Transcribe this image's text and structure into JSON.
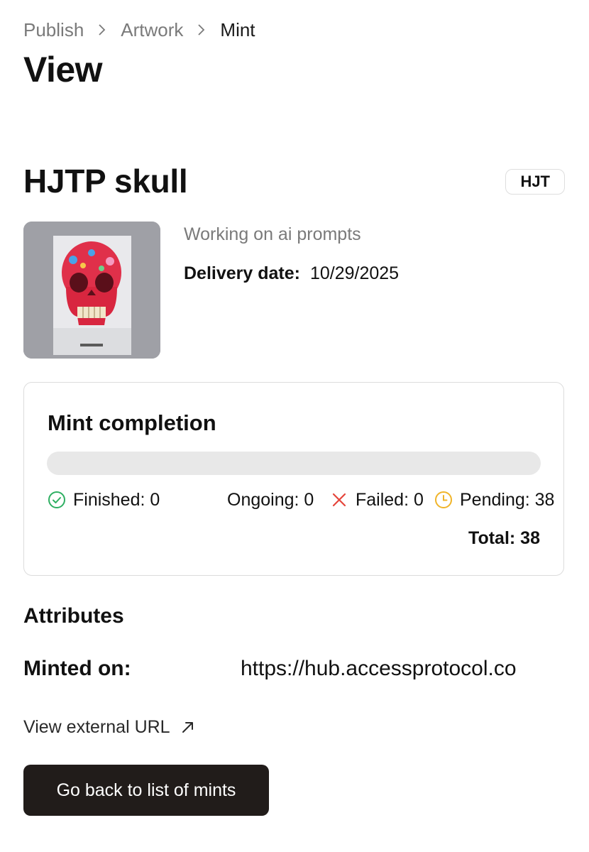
{
  "breadcrumb": {
    "items": [
      {
        "label": "Publish"
      },
      {
        "label": "Artwork"
      },
      {
        "label": "Mint"
      }
    ]
  },
  "page": {
    "title": "View"
  },
  "mint": {
    "name": "HJTP skull",
    "tag": "HJT",
    "description": "Working on ai prompts",
    "delivery_label": "Delivery date:",
    "delivery_date": "10/29/2025",
    "thumbnail_icon": "skull-artwork-image"
  },
  "completion": {
    "title": "Mint completion",
    "progress_fraction": 0,
    "finished_label": "Finished: 0",
    "ongoing_label": "Ongoing: 0",
    "failed_label": "Failed: 0",
    "pending_label": "Pending: 38",
    "total_label": "Total: 38",
    "colors": {
      "finished": "#2eaf62",
      "failed": "#e5453b",
      "pending": "#f0b429",
      "track": "#e8e8e8"
    }
  },
  "attributes": {
    "heading": "Attributes",
    "minted_on_label": "Minted on:",
    "minted_on_value": "https://hub.accessprotocol.co"
  },
  "links": {
    "external_url_label": "View external URL"
  },
  "actions": {
    "back_label": "Go back to list of mints",
    "back_color": "#211c1a"
  }
}
